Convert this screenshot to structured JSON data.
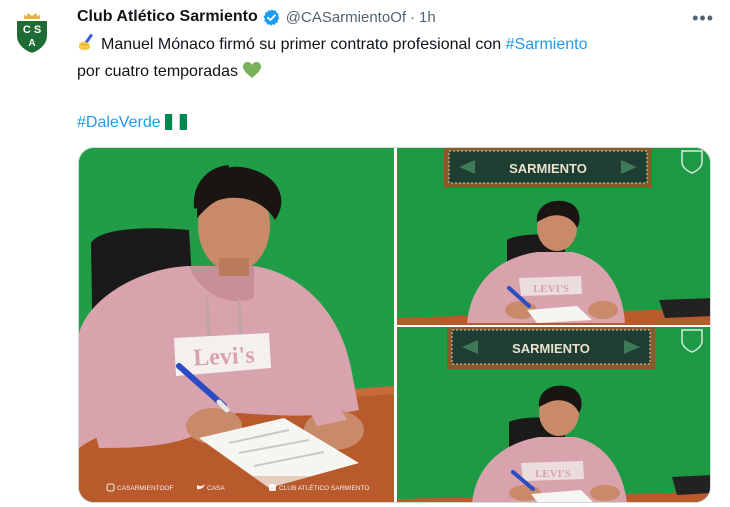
{
  "tweet": {
    "author": {
      "name": "Club Atlético Sarmiento",
      "handle": "@CASarmientoOf",
      "verified": true,
      "avatar_icon": "club-crest-icon",
      "avatar_letters": "CSA"
    },
    "separator": "·",
    "time": "1h",
    "more_label": "•••",
    "body": {
      "line1_text": "Manuel Mónaco firmó su primer contrato profesional con ",
      "line1_hashtag": "#Sarmiento",
      "line2_text": "por cuatro temporadas",
      "hashtag_line": "#DaleVerde",
      "emojis": [
        "writing-hand-icon",
        "green-heart-icon",
        "nigeria-flag-icon"
      ]
    },
    "media": {
      "photos": [
        {
          "id": "photo-main",
          "watermark_instagram": "CASARMIENTOOF",
          "watermark_twitter": "CASA",
          "watermark_facebook": "CLUB ATLÉTICO SARMIENTO",
          "shirt_text": "Levi's"
        },
        {
          "id": "photo-top-right",
          "banner_text": "SARMIENTO",
          "shirt_text": "LEVI'S"
        },
        {
          "id": "photo-bottom-right",
          "banner_text": "SARMIENTO",
          "shirt_text": "LEVI'S"
        }
      ]
    }
  },
  "colors": {
    "accent": "#1d9bf0",
    "wall_green": "#1f9a44",
    "hoodie_pink": "#d9a3ad",
    "desk": "#b85a2c",
    "crest_green": "#1e6b35"
  }
}
